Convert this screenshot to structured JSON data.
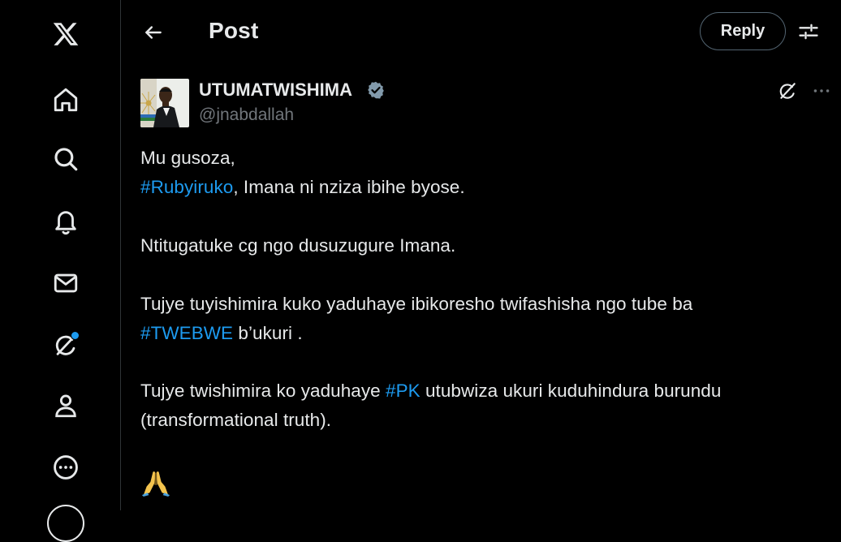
{
  "sidebar": {
    "items": [
      {
        "icon": "x-logo-icon"
      },
      {
        "icon": "home-icon"
      },
      {
        "icon": "search-icon"
      },
      {
        "icon": "notifications-bell-icon"
      },
      {
        "icon": "messages-envelope-icon"
      },
      {
        "icon": "grok-icon",
        "has_badge": true
      },
      {
        "icon": "profile-icon"
      },
      {
        "icon": "more-circle-icon"
      }
    ],
    "badge_color": "#1d9bf0"
  },
  "header": {
    "title": "Post",
    "reply_label": "Reply"
  },
  "post": {
    "author_name": "UTUMATWISHIMA",
    "author_handle": "@jnabdallah",
    "verified": true,
    "lines": {
      "l1": "Mu gusoza,",
      "l2_tag": "#Rubyiruko",
      "l2_rest": ", Imana ni nziza ibihe byose.",
      "l3": "Ntitugatuke cg ngo dusuzugure Imana.",
      "l4": "Tujye  tuyishimira kuko yaduhaye ibikoresho twifashisha ngo tube ba",
      "l5_tag": "#TWEBWE",
      "l5_rest": " b’ukuri .",
      "l6_pre": "Tujye twishimira ko yaduhaye ",
      "l6_tag": "#PK",
      "l6_rest": " utubwiza ukuri kuduhindura burundu",
      "l7": "(transformational truth)."
    },
    "emoji": "folded-hands-emoji"
  },
  "colors": {
    "background": "#000000",
    "text": "#e7e9ea",
    "secondary_text": "#71767b",
    "link": "#1d9bf0",
    "border": "#2f3336"
  }
}
